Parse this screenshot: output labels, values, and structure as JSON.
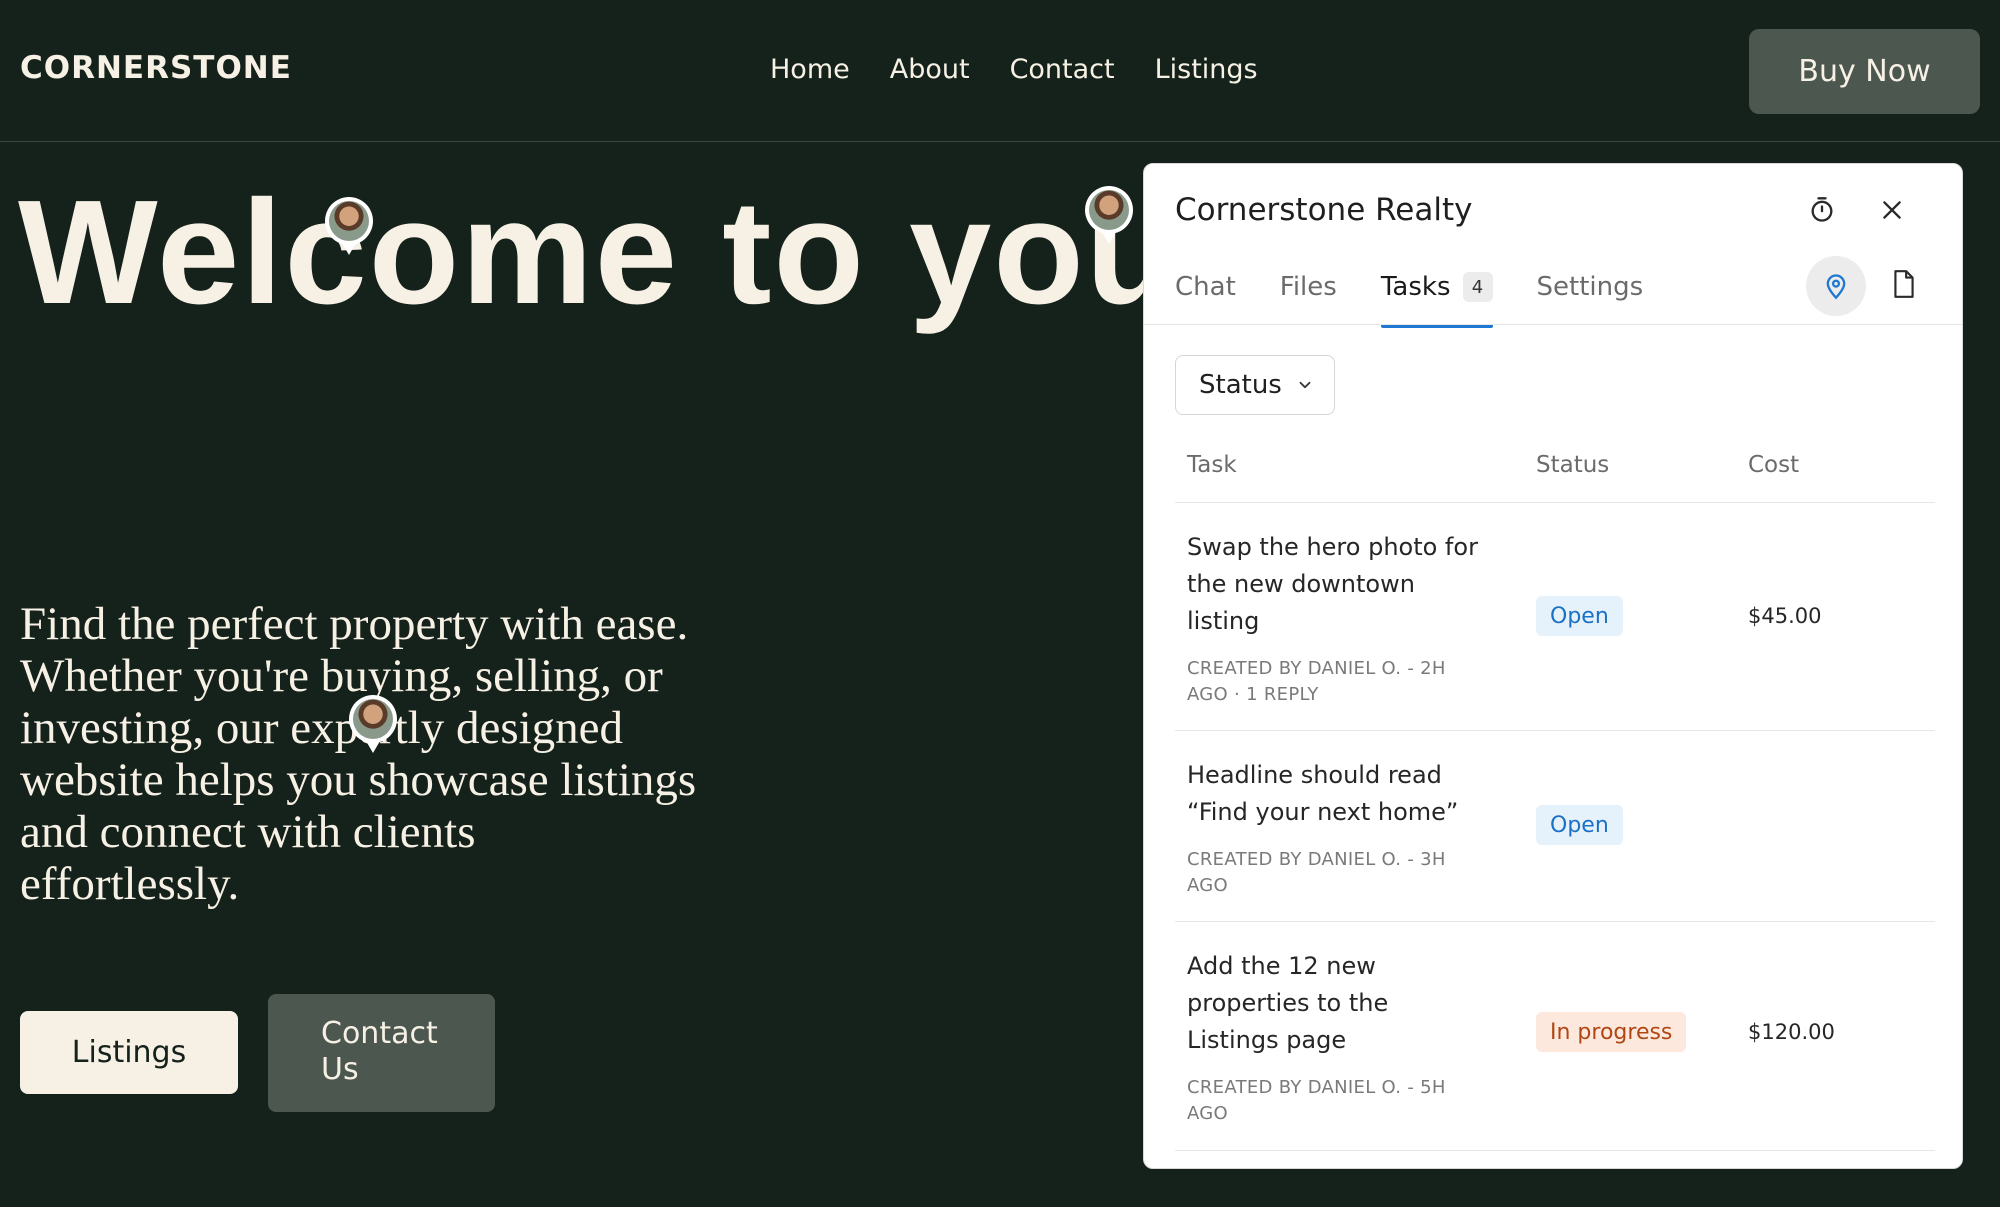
{
  "header": {
    "brand": "CORNERSTONE",
    "nav": [
      "Home",
      "About",
      "Contact",
      "Listings"
    ],
    "buy_label": "Buy Now"
  },
  "hero": {
    "title": "Welcome to your",
    "description": "Find the perfect property with ease. Whether you're buying, selling, or investing, our expertly designed website helps you showcase listings and connect with clients effortlessly.",
    "listings_label": "Listings",
    "contact_label": "Contact Us"
  },
  "panel": {
    "title": "Cornerstone Realty",
    "tabs": {
      "chat": "Chat",
      "files": "Files",
      "tasks": "Tasks",
      "tasks_count": "4",
      "settings": "Settings"
    },
    "filter_label": "Status",
    "columns": {
      "task": "Task",
      "status": "Status",
      "cost": "Cost"
    },
    "rows": [
      {
        "title": "Swap the hero photo for the new downtown listing",
        "meta": "CREATED BY DANIEL O. - 2H AGO · 1 REPLY",
        "status": "Open",
        "cost": "$45.00"
      },
      {
        "title": "Headline should read “Find your next home”",
        "meta": "CREATED BY DANIEL O. - 3H AGO",
        "status": "Open",
        "cost": ""
      },
      {
        "title": "Add the 12 new properties to the Listings page",
        "meta": "CREATED BY DANIEL O. - 5H AGO",
        "status": "In progress",
        "cost": "$120.00"
      }
    ],
    "accent_color": "#1f78d1"
  }
}
